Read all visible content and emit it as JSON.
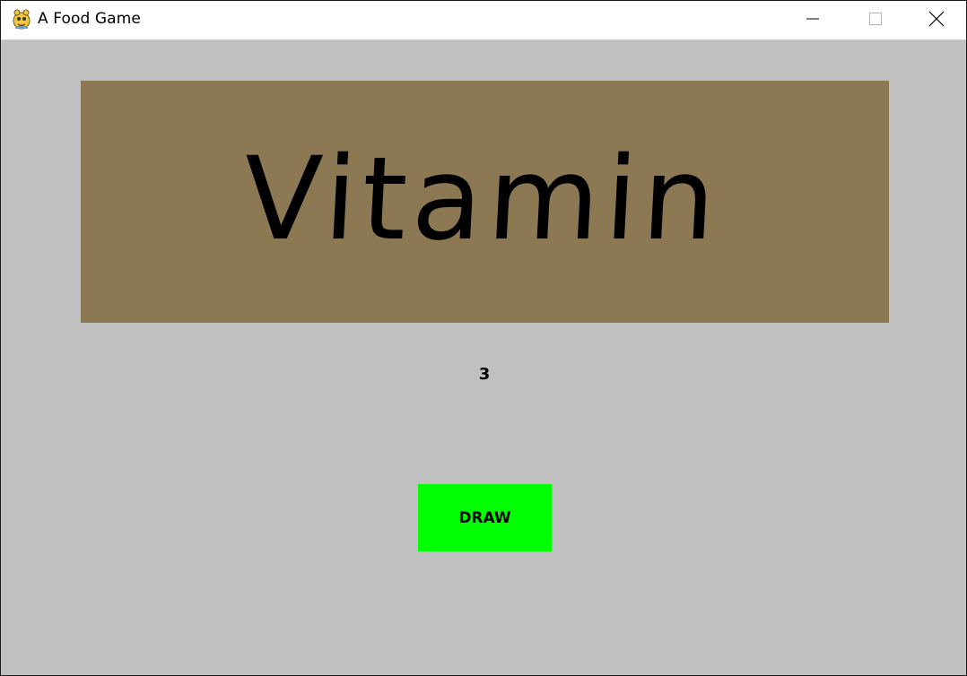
{
  "window": {
    "title": "A Food Game",
    "icon": "pygame-snake-icon",
    "controls": [
      "minimize-icon",
      "maximize-icon",
      "close-icon"
    ]
  },
  "game": {
    "word": "Vitamin",
    "count": "3",
    "draw_label": "DRAW"
  },
  "colors": {
    "background": "#c0c0c0",
    "banner": "#8c7853",
    "draw_button": "#00ff00",
    "titlebar": "#ffffff"
  }
}
